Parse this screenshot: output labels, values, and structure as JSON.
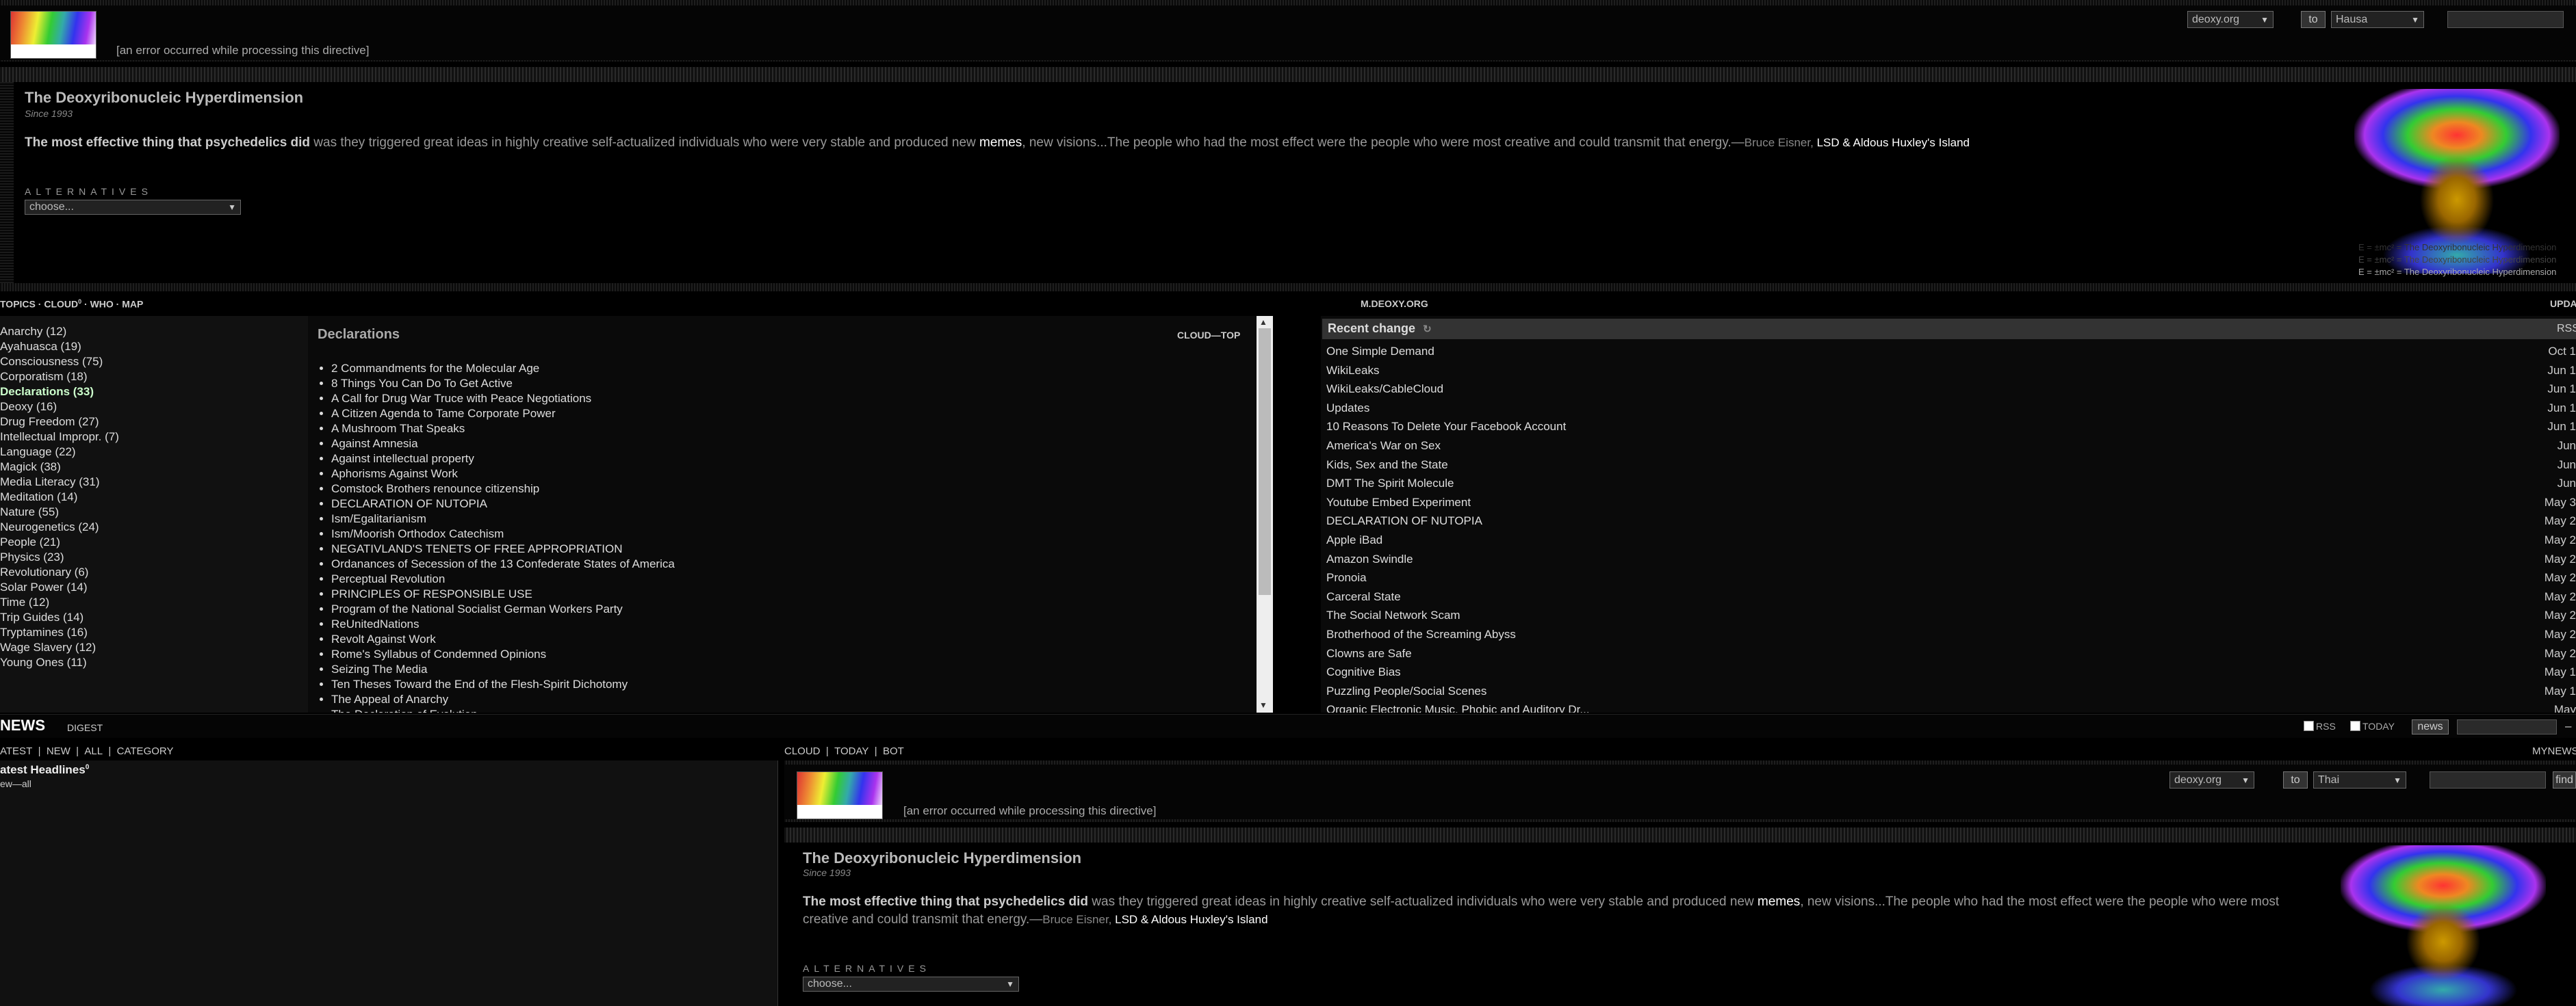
{
  "header": {
    "error_text": "[an error occurred while processing this directive]",
    "site_select": "deoxy.org",
    "to_label": "to",
    "lang_select": "Hausa"
  },
  "intro": {
    "title": "The Deoxyribonucleic Hyperdimension",
    "since": "Since 1993",
    "quote_bold": "The most effective thing that psychedelics did",
    "quote_part1": " was they triggered great ideas in highly creative self-actualized individuals who were very stable and produced new ",
    "quote_memes": "memes",
    "quote_part2": ", new visions...The people who had the most effect were the people who were most creative and could transmit that energy.",
    "quote_dash": "—",
    "author": "Bruce Eisner, ",
    "book": "LSD & Aldous Huxley's Island",
    "alternatives_label": "ALTERNATIVES",
    "alternatives_select": "choose..."
  },
  "emc": {
    "line1": "E = ±mc² = The Deoxyribonucleic Hyperdimension",
    "line2": "E = ±mc² = The Deoxyribonucleic Hyperdimension",
    "line3": "E = ±mc² = The Deoxyribonucleic Hyperdimension"
  },
  "nav": {
    "topics": "TOPICS",
    "cloud": "CLOUD",
    "cloud_sup": "0",
    "who": "WHO",
    "map": "MAP",
    "mdeoxy": "M.DEOXY.ORG",
    "upda": "UPDA"
  },
  "topics": [
    "Anarchy (12)",
    "Ayahuasca (19)",
    "Consciousness (75)",
    "Corporatism (18)",
    "Declarations (33)",
    "Deoxy (16)",
    "Drug Freedom (27)",
    "Intellectual Impropr. (7)",
    "Language (22)",
    "Magick (38)",
    "Media Literacy (31)",
    "Meditation (14)",
    "Nature (55)",
    "Neurogenetics (24)",
    "People (21)",
    "Physics (23)",
    "Revolutionary (6)",
    "Solar Power (14)",
    "Time (12)",
    "Trip Guides (14)",
    "Tryptamines (16)",
    "Wage Slavery (12)",
    "Young Ones (11)"
  ],
  "declarations": {
    "heading": "Declarations",
    "cloud_top": "CLOUD—TOP",
    "items": [
      "2 Commandments for the Molecular Age",
      "8 Things You Can Do To Get Active",
      "A Call for Drug War Truce with Peace Negotiations",
      "A Citizen Agenda to Tame Corporate Power",
      "A Mushroom That Speaks",
      "Against Amnesia",
      "Against intellectual property",
      "Aphorisms Against Work",
      "Comstock Brothers renounce citizenship",
      "DECLARATION OF NUTOPIA",
      "Ism/Egalitarianism",
      "Ism/Moorish Orthodox Catechism",
      "NEGATIVLAND'S TENETS OF FREE APPROPRIATION",
      "Ordanances of Secession of the 13 Confederate States of America",
      "Perceptual Revolution",
      "PRINCIPLES OF RESPONSIBLE USE",
      "Program of the National Socialist German Workers Party",
      "ReUnitedNations",
      "Revolt Against Work",
      "Rome's Syllabus of Condemned Opinions",
      "Seizing The Media",
      "Ten Theses Toward the End of the Flesh-Spirit Dichotomy",
      "The Appeal of Anarchy",
      "The Declaration of Evolution"
    ]
  },
  "recent": {
    "heading": "Recent change",
    "icon": "↻",
    "rss": "RSS",
    "items": [
      {
        "title": "One Simple Demand",
        "date": "Oct 1"
      },
      {
        "title": "WikiLeaks",
        "date": "Jun 1"
      },
      {
        "title": "WikiLeaks/CableCloud",
        "date": "Jun 1"
      },
      {
        "title": "Updates",
        "date": "Jun 1"
      },
      {
        "title": "10 Reasons To Delete Your Facebook Account",
        "date": "Jun 1"
      },
      {
        "title": "America's War on Sex",
        "date": "Jun"
      },
      {
        "title": "Kids, Sex and the State",
        "date": "Jun"
      },
      {
        "title": "DMT The Spirit Molecule",
        "date": "Jun"
      },
      {
        "title": "Youtube Embed Experiment",
        "date": "May 3"
      },
      {
        "title": "DECLARATION OF NUTOPIA",
        "date": "May 2"
      },
      {
        "title": "Apple iBad",
        "date": "May 2"
      },
      {
        "title": "Amazon Swindle",
        "date": "May 2"
      },
      {
        "title": "Pronoia",
        "date": "May 2"
      },
      {
        "title": "Carceral State",
        "date": "May 2"
      },
      {
        "title": "The Social Network Scam",
        "date": "May 2"
      },
      {
        "title": "Brotherhood of the Screaming Abyss",
        "date": "May 2"
      },
      {
        "title": "Clowns are Safe",
        "date": "May 2"
      },
      {
        "title": "Cognitive Bias",
        "date": "May 1"
      },
      {
        "title": "Puzzling People/Social Scenes",
        "date": "May 1"
      },
      {
        "title": "Organic Electronic Music, Phobic and Auditory Dr...",
        "date": "May"
      }
    ]
  },
  "news": {
    "title": "NEWS",
    "digest": "DIGEST",
    "rss_label": "RSS",
    "today_label": "TODAY",
    "news_button": "news",
    "dash": "–",
    "tabs": [
      "ATEST",
      "NEW",
      "ALL",
      "CATEGORY"
    ],
    "right_tabs": [
      "CLOUD",
      "TODAY",
      "BOT"
    ],
    "mynews": "MYNEWS",
    "latest_headlines": "atest Headlines",
    "latest_sup": "0",
    "new_all": "ew—all"
  },
  "embedded": {
    "site_select": "deoxy.org",
    "to_label": "to",
    "lang_select": "Thai",
    "find_button": "find",
    "error_text": "[an error occurred while processing this directive]",
    "title": "The Deoxyribonucleic Hyperdimension",
    "since": "Since 1993",
    "quote_bold": "The most effective thing that psychedelics did",
    "quote_part1": " was they triggered great ideas in highly creative self-actualized individuals who were very stable and produced new ",
    "quote_memes": "memes",
    "quote_part2": ", new visions...The people who had the most effect were the people who were most creative and could transmit that energy.",
    "quote_dash": "—",
    "author": "Bruce Eisner, ",
    "book": "LSD & Aldous Huxley's Island",
    "alternatives_label": "ALTERNATIVES",
    "alternatives_select": "choose..."
  }
}
